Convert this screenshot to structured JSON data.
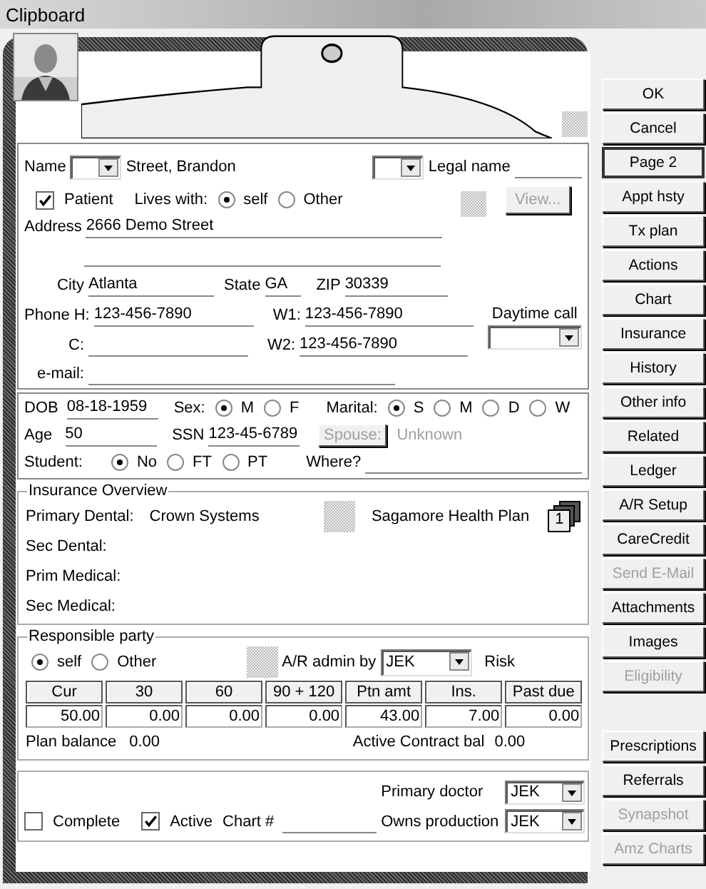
{
  "window": {
    "title": "Clipboard"
  },
  "name": {
    "label": "Name",
    "value": "Street, Brandon",
    "legal_label": "Legal name"
  },
  "patient": {
    "label": "Patient",
    "checked": true
  },
  "lives_with": {
    "label": "Lives with:",
    "options": [
      {
        "label": "self",
        "selected": true
      },
      {
        "label": "Other",
        "selected": false
      }
    ]
  },
  "view_button": {
    "label": "View...",
    "disabled": true
  },
  "address": {
    "label": "Address",
    "value": "2666 Demo Street"
  },
  "city": {
    "label": "City",
    "value": "Atlanta"
  },
  "state": {
    "label": "State",
    "value": "GA"
  },
  "zip": {
    "label": "ZIP",
    "value": "30339"
  },
  "phone_h": {
    "label": "Phone H:",
    "value": "123-456-7890"
  },
  "phone_w1": {
    "label": "W1:",
    "value": "123-456-7890"
  },
  "phone_c": {
    "label": "C:"
  },
  "phone_w2": {
    "label": "W2:",
    "value": "123-456-7890"
  },
  "email": {
    "label": "e-mail:"
  },
  "daytime_call": {
    "label": "Daytime call"
  },
  "dob": {
    "label": "DOB",
    "value": "08-18-1959"
  },
  "sex": {
    "label": "Sex:",
    "options": [
      {
        "label": "M",
        "selected": true
      },
      {
        "label": "F",
        "selected": false
      }
    ]
  },
  "marital": {
    "label": "Marital:",
    "options": [
      {
        "label": "S",
        "selected": true
      },
      {
        "label": "M",
        "selected": false
      },
      {
        "label": "D",
        "selected": false
      },
      {
        "label": "W",
        "selected": false
      }
    ]
  },
  "age": {
    "label": "Age",
    "value": "50"
  },
  "ssn": {
    "label": "SSN",
    "value": "123-45-6789"
  },
  "spouse": {
    "button": "Spouse:",
    "value": "Unknown",
    "disabled": true
  },
  "student": {
    "label": "Student:",
    "options": [
      {
        "label": "No",
        "selected": true
      },
      {
        "label": "FT",
        "selected": false
      },
      {
        "label": "PT",
        "selected": false
      }
    ]
  },
  "where": {
    "label": "Where?"
  },
  "insurance": {
    "title": "Insurance Overview",
    "plan": "Sagamore Health Plan",
    "badge": "1",
    "rows": [
      {
        "label": "Primary Dental:",
        "value": "Crown Systems"
      },
      {
        "label": "Sec Dental:"
      },
      {
        "label": "Prim Medical:"
      },
      {
        "label": "Sec Medical:"
      }
    ]
  },
  "responsible": {
    "title": "Responsible party",
    "options": [
      {
        "label": "self",
        "selected": true
      },
      {
        "label": "Other",
        "selected": false
      }
    ],
    "ar_label": "A/R admin by",
    "ar_value": "JEK",
    "risk": "Risk",
    "aging": [
      {
        "label": "Cur",
        "value": "50.00"
      },
      {
        "label": "30",
        "value": "0.00"
      },
      {
        "label": "60",
        "value": "0.00"
      },
      {
        "label": "90 + 120",
        "value": "0.00"
      },
      {
        "label": "Ptn amt",
        "value": "43.00"
      },
      {
        "label": "Ins.",
        "value": "7.00"
      },
      {
        "label": "Past due",
        "value": "0.00"
      }
    ],
    "plan_balance": {
      "label": "Plan balance",
      "value": "0.00"
    },
    "contract_balance": {
      "label": "Active Contract bal",
      "value": "0.00"
    }
  },
  "status": {
    "complete": {
      "label": "Complete",
      "checked": false
    },
    "active": {
      "label": "Active",
      "checked": true
    },
    "chart_label": "Chart #",
    "primary_doctor": {
      "label": "Primary doctor",
      "value": "JEK"
    },
    "owns_production": {
      "label": "Owns production",
      "value": "JEK"
    }
  },
  "buttons": [
    {
      "label": "OK",
      "disabled": false,
      "focused": false
    },
    {
      "label": "Cancel",
      "disabled": false,
      "focused": false
    },
    {
      "label": "Page 2",
      "disabled": false,
      "focused": true
    },
    {
      "label": "Appt hsty",
      "disabled": false,
      "focused": false
    },
    {
      "label": "Tx plan",
      "disabled": false,
      "focused": false
    },
    {
      "label": "Actions",
      "disabled": false,
      "focused": false
    },
    {
      "label": "Chart",
      "disabled": false,
      "focused": false
    },
    {
      "label": "Insurance",
      "disabled": false,
      "focused": false
    },
    {
      "label": "History",
      "disabled": false,
      "focused": false
    },
    {
      "label": "Other info",
      "disabled": false,
      "focused": false
    },
    {
      "label": "Related",
      "disabled": false,
      "focused": false
    },
    {
      "label": "Ledger",
      "disabled": false,
      "focused": false
    },
    {
      "label": "A/R Setup",
      "disabled": false,
      "focused": false
    },
    {
      "label": "CareCredit",
      "disabled": false,
      "focused": false
    },
    {
      "label": "Send E-Mail",
      "disabled": true,
      "focused": false
    },
    {
      "label": "Attachments",
      "disabled": false,
      "focused": false
    },
    {
      "label": "Images",
      "disabled": false,
      "focused": false
    },
    {
      "label": "Eligibility",
      "disabled": true,
      "focused": false
    }
  ],
  "lower_buttons": [
    {
      "label": "Prescriptions",
      "disabled": false,
      "focused": false
    },
    {
      "label": "Referrals",
      "disabled": false,
      "focused": false
    },
    {
      "label": "Synapshot",
      "disabled": true,
      "focused": false
    },
    {
      "label": "Amz Charts",
      "disabled": true,
      "focused": false
    }
  ]
}
